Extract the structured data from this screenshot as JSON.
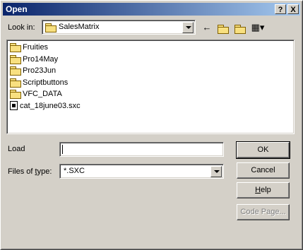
{
  "window": {
    "title": "Open"
  },
  "titlebar": {
    "help_label": "?",
    "close_label": "X"
  },
  "lookin": {
    "label": "Look in:",
    "value": "SalesMatrix"
  },
  "toolbar": {
    "back_icon": "back-arrow-icon",
    "up_icon": "up-folder-icon",
    "new_folder_icon": "new-folder-icon",
    "view_icon": "view-menu-icon"
  },
  "files": [
    {
      "name": "Fruities",
      "type": "folder"
    },
    {
      "name": "Pro14May",
      "type": "folder"
    },
    {
      "name": "Pro23Jun",
      "type": "folder"
    },
    {
      "name": "Scriptbuttons",
      "type": "folder"
    },
    {
      "name": "VFC_DATA",
      "type": "folder"
    },
    {
      "name": "cat_18june03.sxc",
      "type": "file"
    }
  ],
  "load": {
    "label": "Load",
    "value": ""
  },
  "filetype": {
    "label": "Files of type:",
    "value": "*.SXC"
  },
  "buttons": {
    "ok": "OK",
    "cancel": "Cancel",
    "help": "Help",
    "codepage": "Code Page..."
  }
}
